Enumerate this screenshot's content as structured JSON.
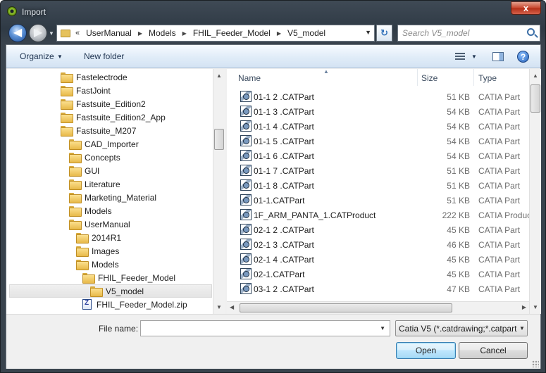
{
  "window": {
    "title": "Import",
    "close_label": "x"
  },
  "navigation": {
    "back_glyph": "◀",
    "forward_glyph": "▶",
    "address_prefix": "«",
    "breadcrumbs": [
      "UserManual",
      "Models",
      "FHIL_Feeder_Model",
      "V5_model"
    ],
    "refresh_glyph": "↻"
  },
  "search": {
    "placeholder": "Search V5_model",
    "value": ""
  },
  "toolbar": {
    "organize_label": "Organize",
    "new_folder_label": "New folder",
    "help_label": "?"
  },
  "tree": {
    "items": [
      {
        "label": "Fastelectrode",
        "indent": 0,
        "icon": "folder-icon"
      },
      {
        "label": "FastJoint",
        "indent": 0,
        "icon": "folder-icon"
      },
      {
        "label": "Fastsuite_Edition2",
        "indent": 0,
        "icon": "folder-icon"
      },
      {
        "label": "Fastsuite_Edition2_App",
        "indent": 0,
        "icon": "folder-icon"
      },
      {
        "label": "Fastsuite_M207",
        "indent": 0,
        "icon": "folder-icon"
      },
      {
        "label": "CAD_Importer",
        "indent": 1,
        "icon": "folder-icon"
      },
      {
        "label": "Concepts",
        "indent": 1,
        "icon": "folder-icon"
      },
      {
        "label": "GUI",
        "indent": 1,
        "icon": "folder-icon"
      },
      {
        "label": "Literature",
        "indent": 1,
        "icon": "folder-icon"
      },
      {
        "label": "Marketing_Material",
        "indent": 1,
        "icon": "folder-icon"
      },
      {
        "label": "Models",
        "indent": 1,
        "icon": "folder-icon"
      },
      {
        "label": "UserManual",
        "indent": 1,
        "icon": "folder-icon"
      },
      {
        "label": "2014R1",
        "indent": 2,
        "icon": "folder-icon"
      },
      {
        "label": "Images",
        "indent": 2,
        "icon": "folder-icon"
      },
      {
        "label": "Models",
        "indent": 2,
        "icon": "folder-icon"
      },
      {
        "label": "FHIL_Feeder_Model",
        "indent": 3,
        "icon": "folder-icon"
      },
      {
        "label": "V5_model",
        "indent": 4,
        "icon": "folder-icon",
        "selected": true
      },
      {
        "label": "FHIL_Feeder_Model.zip",
        "indent": 3,
        "icon": "zip-icon"
      }
    ]
  },
  "filelist": {
    "columns": {
      "name": "Name",
      "size": "Size",
      "type": "Type"
    },
    "rows": [
      {
        "name": "01-1 2 .CATPart",
        "size": "51 KB",
        "type": "CATIA Part"
      },
      {
        "name": "01-1 3 .CATPart",
        "size": "54 KB",
        "type": "CATIA Part"
      },
      {
        "name": "01-1 4 .CATPart",
        "size": "54 KB",
        "type": "CATIA Part"
      },
      {
        "name": "01-1 5 .CATPart",
        "size": "54 KB",
        "type": "CATIA Part"
      },
      {
        "name": "01-1 6 .CATPart",
        "size": "54 KB",
        "type": "CATIA Part"
      },
      {
        "name": "01-1 7 .CATPart",
        "size": "51 KB",
        "type": "CATIA Part"
      },
      {
        "name": "01-1 8 .CATPart",
        "size": "51 KB",
        "type": "CATIA Part"
      },
      {
        "name": "01-1.CATPart",
        "size": "51 KB",
        "type": "CATIA Part"
      },
      {
        "name": "1F_ARM_PANTA_1.CATProduct",
        "size": "222 KB",
        "type": "CATIA Product"
      },
      {
        "name": "02-1 2 .CATPart",
        "size": "45 KB",
        "type": "CATIA Part"
      },
      {
        "name": "02-1 3 .CATPart",
        "size": "46 KB",
        "type": "CATIA Part"
      },
      {
        "name": "02-1 4 .CATPart",
        "size": "45 KB",
        "type": "CATIA Part"
      },
      {
        "name": "02-1.CATPart",
        "size": "45 KB",
        "type": "CATIA Part"
      },
      {
        "name": "03-1 2 .CATPart",
        "size": "47 KB",
        "type": "CATIA Part"
      }
    ]
  },
  "bottom": {
    "file_name_label": "File name:",
    "file_name_value": "",
    "filter_value": "Catia V5 (*.catdrawing;*.catpart",
    "open_label": "Open",
    "cancel_label": "Cancel"
  },
  "colors": {
    "title_bar": "#2f3a45",
    "toolbar": "#e0ecf8",
    "folder": "#e8b949",
    "open_button": "#bee6fd",
    "close_button": "#c9452c"
  }
}
